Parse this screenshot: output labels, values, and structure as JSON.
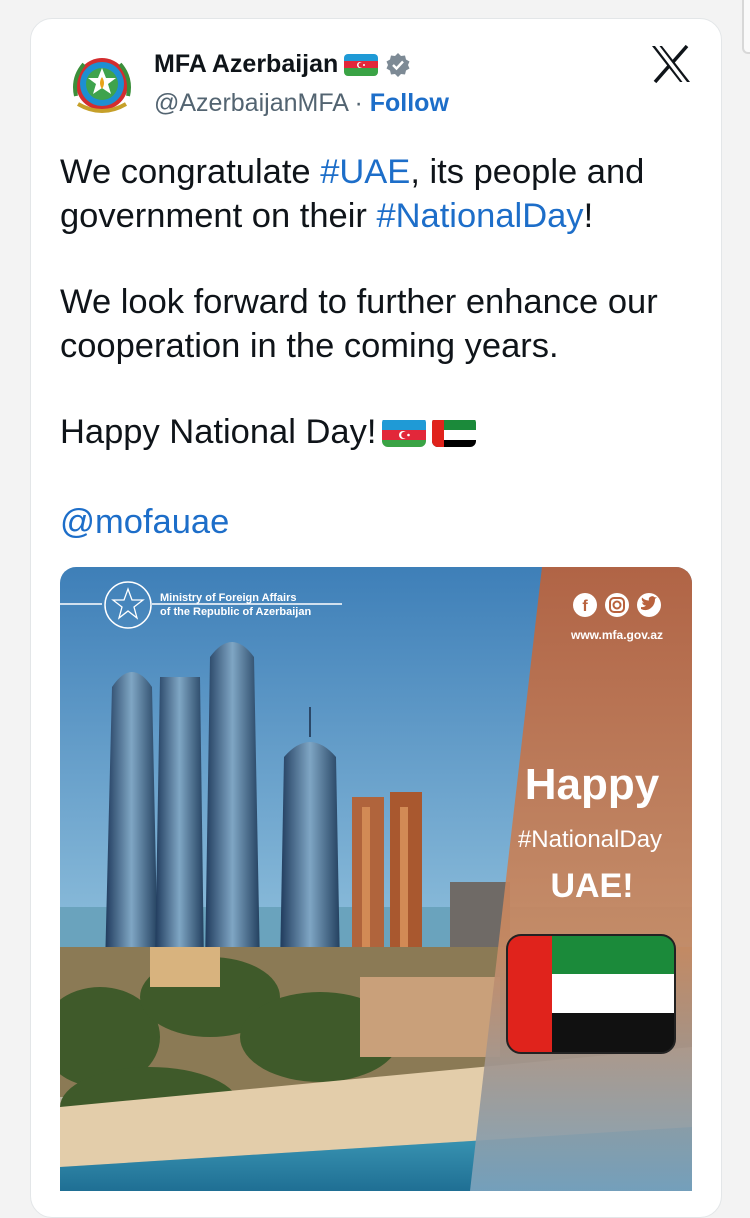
{
  "account": {
    "display_name": "MFA Azerbaijan",
    "handle": "@AzerbaijanMFA",
    "separator": " · ",
    "follow_label": "Follow",
    "avatar": "azerbaijan-emblem-icon",
    "verified_icon": "verified-badge-icon",
    "name_flag_icon": "azerbaijan-flag-icon"
  },
  "brand_icon": "x-logo-icon",
  "tweet": {
    "para1_pre": "We congratulate ",
    "para1_tag1": "#UAE",
    "para1_mid": ", its people and government on their ",
    "para1_tag2": "#NationalDay",
    "para1_post": "!",
    "para2": "We look forward to further enhance our cooperation in the coming years.",
    "para3": "Happy National Day!",
    "para3_emojis": [
      "azerbaijan-flag-emoji",
      "uae-flag-emoji"
    ],
    "mention": "@mofauae"
  },
  "media": {
    "ministry_line1": "Ministry of Foreign Affairs",
    "ministry_line2": "of the Republic of Azerbaijan",
    "website": "www.mfa.gov.az",
    "social_icons": [
      "facebook-icon",
      "instagram-icon",
      "twitter-icon"
    ],
    "headline": "Happy",
    "hashtag": "#NationalDay",
    "country": "UAE!"
  },
  "colors": {
    "link": "#1d6ec9",
    "text": "#0f1419",
    "muted": "#536471",
    "panel": "#c4673f",
    "uae_red": "#e0231c",
    "uae_green": "#1b8a3a",
    "az_blue": "#1f9ad6",
    "az_red": "#e2273a",
    "az_green": "#3aa345"
  }
}
